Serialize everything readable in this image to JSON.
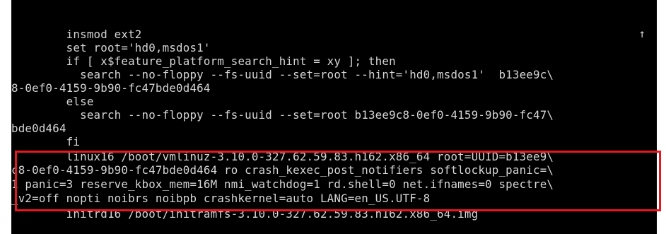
{
  "console": {
    "lines": [
      "        insmod ext2",
      "        set root='hd0,msdos1'",
      "        if [ x$feature_platform_search_hint = xy ]; then",
      "          search --no-floppy --fs-uuid --set=root --hint='hd0,msdos1'  b13ee9c\\",
      "8-0ef0-4159-9b90-fc47bde0d464",
      "        else",
      "          search --no-floppy --fs-uuid --set=root b13ee9c8-0ef0-4159-9b90-fc47\\",
      "bde0d464",
      "        fi",
      "        linux16 /boot/vmlinuz-3.10.0-327.62.59.83.h162.x86_64 root=UUID=b13ee9\\",
      "c8-0ef0-4159-9b90-fc47bde0d464 ro crash_kexec_post_notifiers softlockup_panic=\\",
      "1 panic=3 reserve_kbox_mem=16M nmi_watchdog=1 rd.shell=0 net.ifnames=0 spectre\\",
      "_v2=off nopti noibrs noibpb crashkernel=auto LANG=en_US.UTF-8",
      "        initrd16 /boot/initramfs-3.10.0-327.62.59.83.h162.x86_64.img"
    ],
    "scroll_indicator": "↑"
  },
  "colors": {
    "background": "#000000",
    "text": "#d6d6d6",
    "highlight": "#e8161e"
  }
}
